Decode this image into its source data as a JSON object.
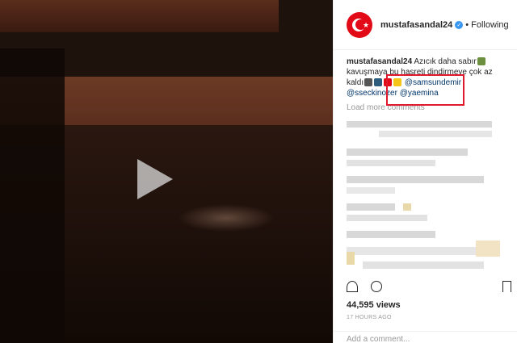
{
  "post": {
    "username": "mustafasandal24",
    "follow_status": "Following",
    "separator": "•",
    "caption": {
      "user": "mustafasandal24",
      "text_line1": " Azıcık daha sabır",
      "text_line2": "kavuşmaya bu hasreti dindirmeye çok az",
      "text_line3": "kaldı",
      "mention1": "@samsundemir",
      "mention2": "@sseckinozer",
      "mention3": "@yaemina"
    },
    "load_more": "Load more comments",
    "views": "44,595 views",
    "time": "17 HOURS AGO",
    "add_comment": "Add a comment..."
  },
  "colors": {
    "brand_red": "#e30a17",
    "highlight_red": "#e0192c",
    "verified_blue": "#3897f0"
  },
  "icons": [
    "play-icon",
    "heart-icon",
    "comment-icon",
    "bookmark-icon",
    "verified-icon"
  ]
}
